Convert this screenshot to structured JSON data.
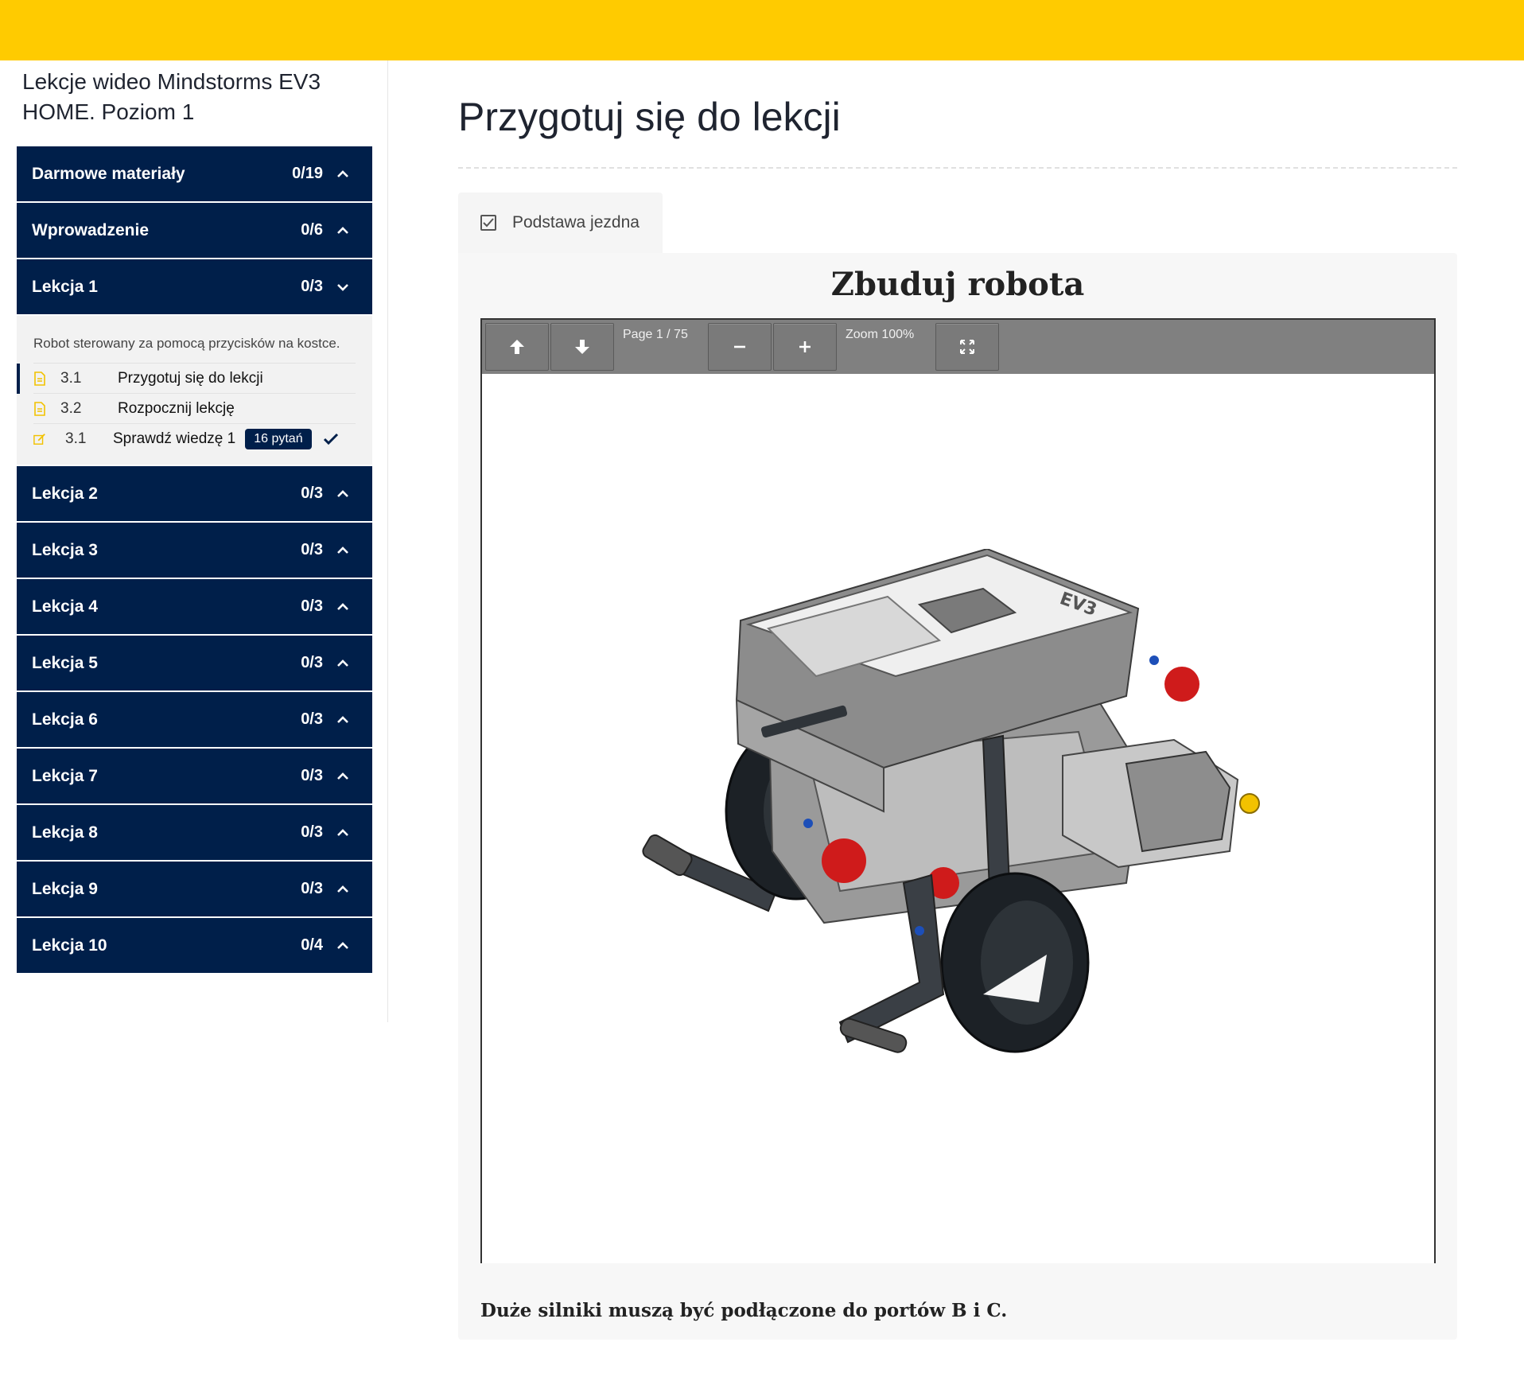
{
  "course": {
    "title": "Lekcje wideo Mindstorms EV3 HOME. Poziom 1"
  },
  "sidebar": {
    "sections_before": [
      {
        "label": "Darmowe materiały",
        "count": "0/19"
      },
      {
        "label": "Wprowadzenie",
        "count": "0/6"
      }
    ],
    "open_section": {
      "label": "Lekcja 1",
      "count": "0/3",
      "description": "Robot sterowany za pomocą przycisków na kostce.",
      "items": [
        {
          "num": "3.1",
          "title": "Przygotuj się do lekcji",
          "icon": "document-icon"
        },
        {
          "num": "3.2",
          "title": "Rozpocznij lekcję",
          "icon": "document-icon"
        },
        {
          "num": "3.1",
          "title": "Sprawdź wiedzę 1",
          "icon": "quiz-edit-icon",
          "badge": "16 pytań"
        }
      ]
    },
    "sections_after": [
      {
        "label": "Lekcja 2",
        "count": "0/3"
      },
      {
        "label": "Lekcja 3",
        "count": "0/3"
      },
      {
        "label": "Lekcja 4",
        "count": "0/3"
      },
      {
        "label": "Lekcja 5",
        "count": "0/3"
      },
      {
        "label": "Lekcja 6",
        "count": "0/3"
      },
      {
        "label": "Lekcja 7",
        "count": "0/3"
      },
      {
        "label": "Lekcja 8",
        "count": "0/3"
      },
      {
        "label": "Lekcja 9",
        "count": "0/3"
      },
      {
        "label": "Lekcja 10",
        "count": "0/4"
      }
    ]
  },
  "main": {
    "page_title": "Przygotuj się do lekcji",
    "tab_label": "Podstawa jezdna",
    "panel_heading": "Zbuduj robota",
    "viewer": {
      "page_text": "Page 1 / 75",
      "zoom_text": "Zoom 100%"
    },
    "caption": "Duże silniki muszą być podłączone do portów B i C."
  },
  "colors": {
    "topbar": "#ffcb00",
    "nav": "#001f4a",
    "accent_icon": "#f2c200"
  }
}
